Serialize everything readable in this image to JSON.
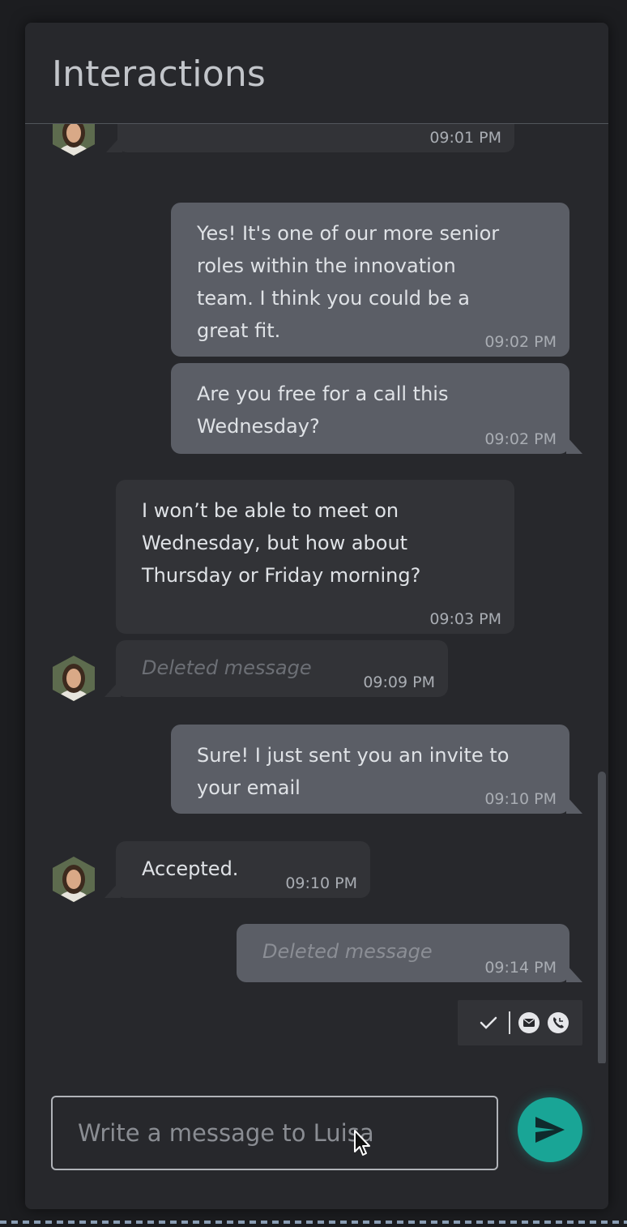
{
  "header": {
    "title": "Interactions"
  },
  "messages": [
    {
      "direction": "in",
      "text": "",
      "time": "09:01 PM"
    },
    {
      "direction": "out",
      "text": "Yes! It's one of our more senior\nroles within the innovation\nteam. I think you could be a\ngreat fit.",
      "time": "09:02 PM"
    },
    {
      "direction": "out",
      "text": "Are you free for a call this\nWednesday?",
      "time": "09:02 PM"
    },
    {
      "direction": "in",
      "text": "I won’t be able to meet on\nWednesday, but how about\nThursday or Friday morning?",
      "time": "09:03 PM"
    },
    {
      "direction": "in",
      "text": "Deleted message",
      "time": "09:09 PM",
      "deleted": true
    },
    {
      "direction": "out",
      "text": "Sure! I just sent you an invite to\nyour email",
      "time": "09:10 PM"
    },
    {
      "direction": "in",
      "text": "Accepted.",
      "time": "09:10 PM"
    },
    {
      "direction": "out",
      "text": "Deleted message",
      "time": "09:14 PM",
      "deleted": true
    }
  ],
  "status_icons": [
    "check-icon",
    "mail-icon",
    "phone-icon"
  ],
  "composer": {
    "placeholder": "Write a message to Luisa"
  },
  "colors": {
    "accent": "#19a596",
    "incoming": "#323337",
    "outgoing": "#5b5e66"
  }
}
